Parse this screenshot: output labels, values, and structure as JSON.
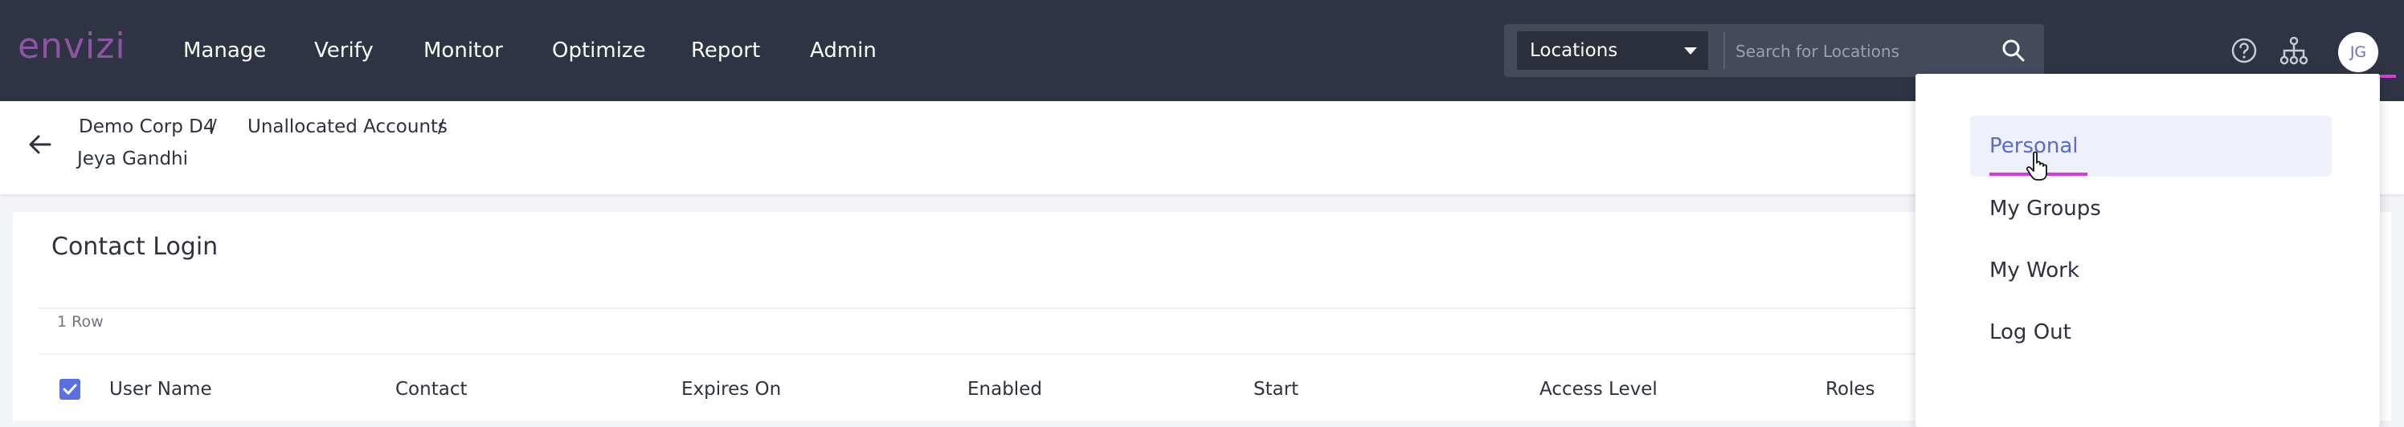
{
  "header": {
    "logo_text": "envizi",
    "nav": [
      "Manage",
      "Verify",
      "Monitor",
      "Optimize",
      "Report",
      "Admin"
    ],
    "location_select": "Locations",
    "search_placeholder": "Search for Locations",
    "avatar_initials": "JG",
    "icons": [
      "search-icon",
      "help-icon",
      "hierarchy-icon"
    ]
  },
  "breadcrumb": {
    "items": [
      "Demo Corp D4",
      "Unallocated Accounts",
      "Jeya Gandhi"
    ],
    "separator": "/"
  },
  "card": {
    "title": "Contact Login",
    "row_count": "1 Row",
    "columns": [
      "User Name",
      "Contact",
      "Expires On",
      "Enabled",
      "Start",
      "Access Level",
      "Roles"
    ]
  },
  "user_menu": {
    "items": [
      "Personal",
      "My Groups",
      "My Work",
      "Log Out"
    ],
    "active": "Personal"
  },
  "colors": {
    "topbar": "#2f3444",
    "brand": "#8f54a6",
    "accent": "#5b6fe0",
    "highlight": "#d43dd9"
  }
}
